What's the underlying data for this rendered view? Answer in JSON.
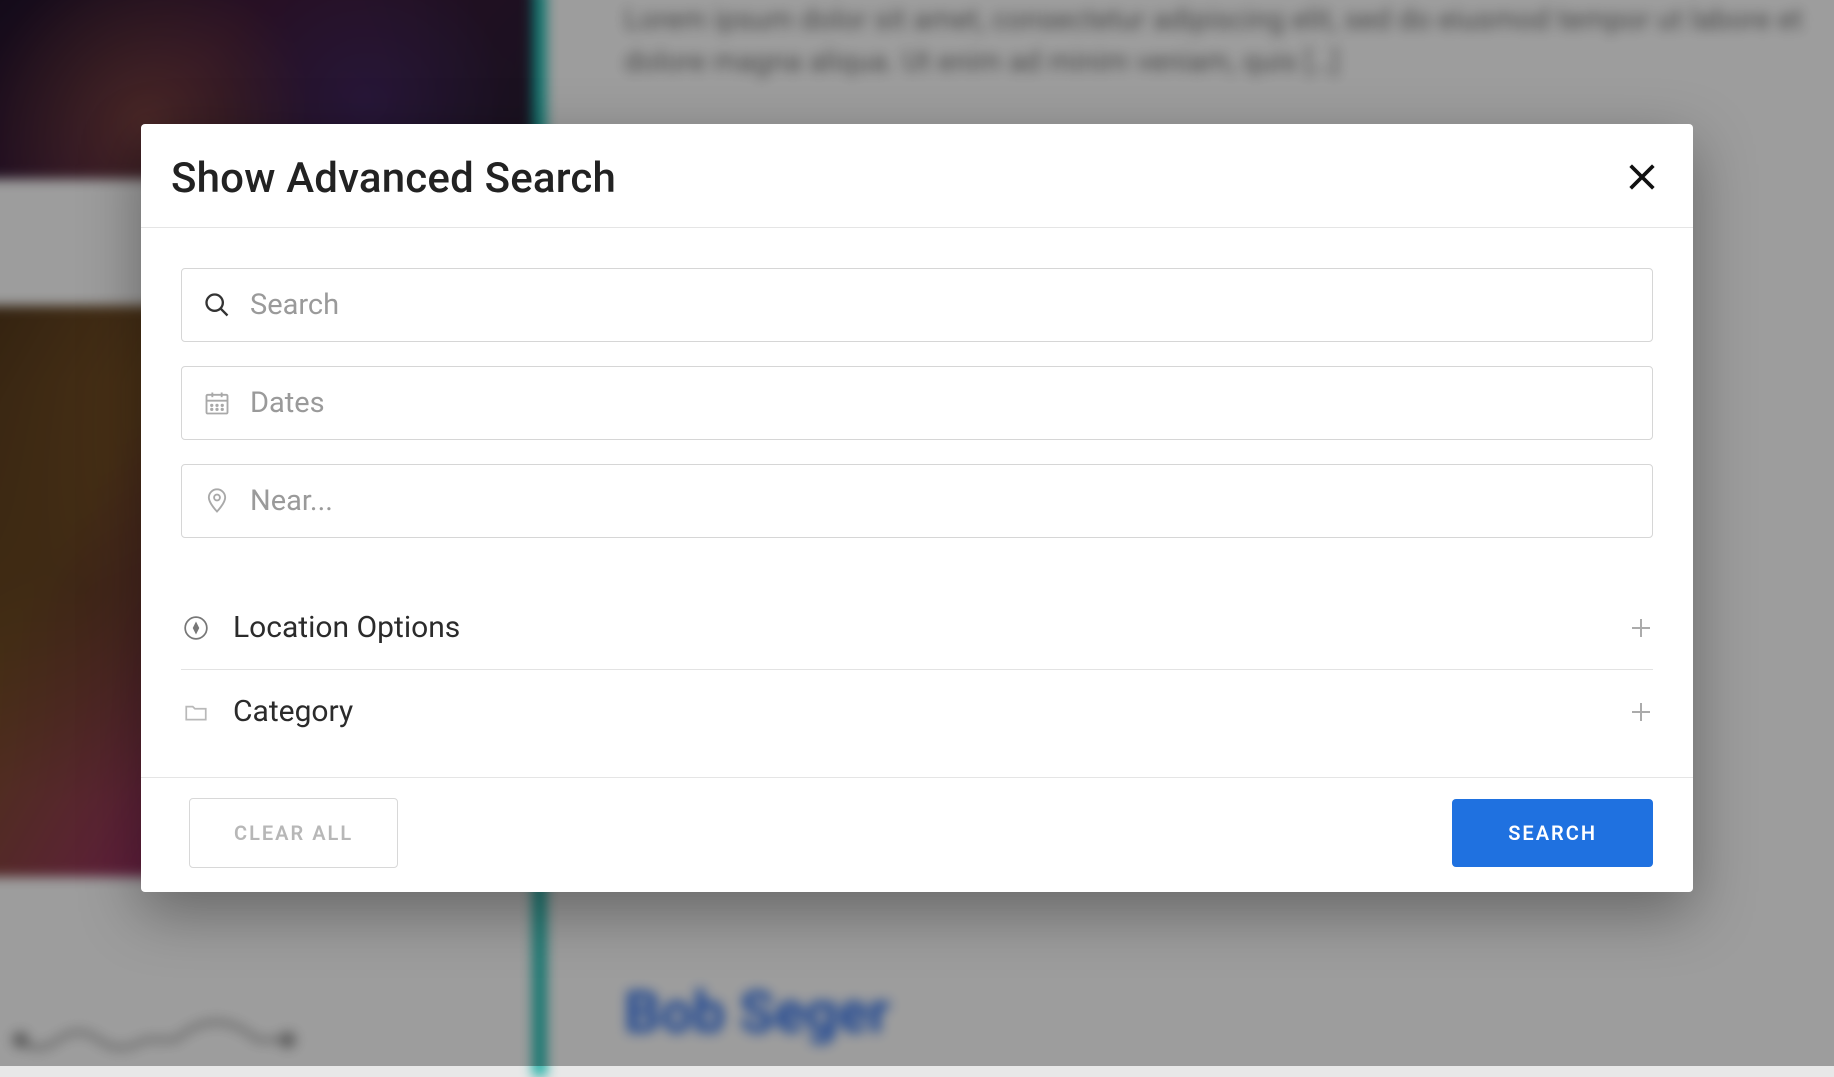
{
  "background": {
    "lorem": "Lorem ipsum dolor sit amet, consectetur adipiscing elit, sed do eiusmod tempor ut labore et dolore magna aliqua. Ut enim ad minim veniam, quis […]",
    "artist": "Bob Seger"
  },
  "modal": {
    "title": "Show Advanced Search",
    "fields": {
      "search_placeholder": "Search",
      "dates_placeholder": "Dates",
      "near_placeholder": "Near..."
    },
    "accordion": {
      "location_label": "Location Options",
      "category_label": "Category"
    },
    "buttons": {
      "clear": "CLEAR ALL",
      "search": "SEARCH"
    }
  }
}
